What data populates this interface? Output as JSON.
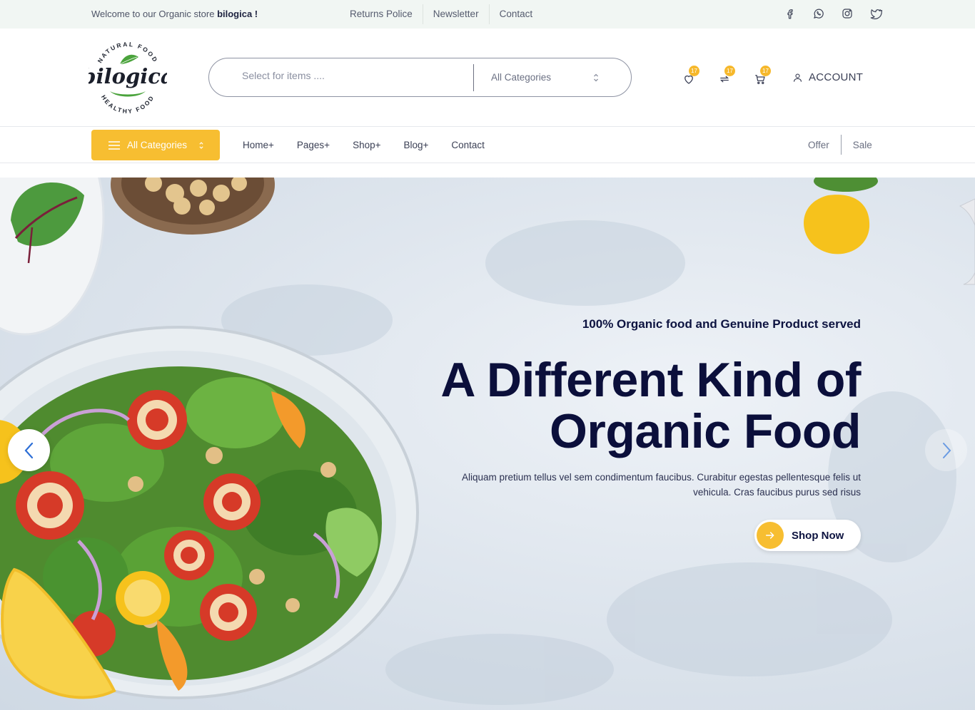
{
  "topbar": {
    "welcome_prefix": "Welcome to our Organic store ",
    "store_name": "bilogica !",
    "links": [
      "Returns Police",
      "Newsletter",
      "Contact"
    ],
    "social_icons": [
      "facebook-icon",
      "whatsapp-icon",
      "instagram-icon",
      "twitter-icon"
    ]
  },
  "header": {
    "logo": {
      "wordmark": "bilogica",
      "top_arc": "NATURAL FOOD",
      "bottom_arc": "HEALTHY FOOD"
    },
    "search": {
      "placeholder": "Select for items ....",
      "category": "All Categories"
    },
    "icons": [
      {
        "name": "wishlist-icon",
        "count": "17"
      },
      {
        "name": "compare-icon",
        "count": "17"
      },
      {
        "name": "cart-icon",
        "count": "17"
      }
    ],
    "account_label": "ACCOUNT"
  },
  "nav": {
    "all_categories": "All Categories",
    "links": [
      "Home+",
      "Pages+",
      "Shop+",
      "Blog+",
      "Contact"
    ],
    "offer": "Offer",
    "sale": "Sale"
  },
  "hero": {
    "tagline": "100% Organic food and Genuine Product served",
    "headline_line1": "A Different Kind of",
    "headline_line2": "Organic Food",
    "description": "Aliquam pretium tellus vel sem condimentum faucibus. Curabitur egestas pellentesque felis ut vehicula. Cras faucibus purus sed risus",
    "cta": "Shop Now"
  },
  "colors": {
    "accent": "#f7be31",
    "navy": "#0b0f3b",
    "topbar_bg": "#f1f6f3",
    "logo_green": "#4aa33c"
  }
}
